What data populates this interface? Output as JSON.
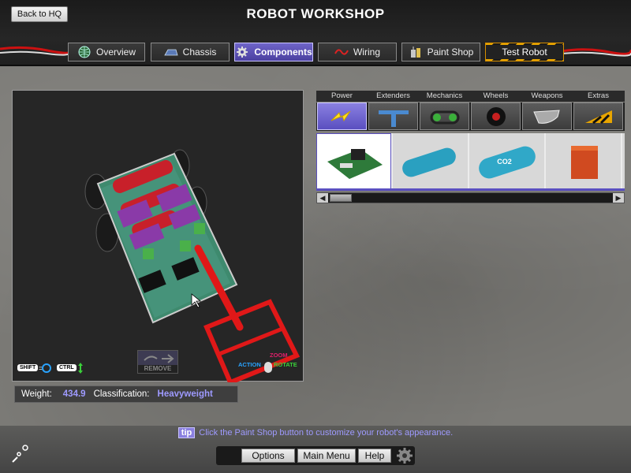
{
  "header": {
    "back_label": "Back to HQ",
    "title": "ROBOT WORKSHOP",
    "tabs": [
      {
        "label": "Overview",
        "icon": "globe-icon"
      },
      {
        "label": "Chassis",
        "icon": "chassis-icon"
      },
      {
        "label": "Components",
        "icon": "gear-icon",
        "active": true
      },
      {
        "label": "Wiring",
        "icon": "wire-icon"
      },
      {
        "label": "Paint Shop",
        "icon": "paint-can-icon"
      },
      {
        "label": "Test Robot",
        "icon": "hazard-stripes"
      }
    ]
  },
  "viewport": {
    "shift_key": "SHIFT",
    "ctrl_key": "CTRL",
    "remove_label": "REMOVE",
    "zoom_label": "ZOOM",
    "action_label": "ACTION",
    "rotate_label": "ROTATE"
  },
  "status": {
    "weight_label": "Weight:",
    "weight_value": "434.9",
    "class_label": "Classification:",
    "class_value": "Heavyweight"
  },
  "parts": {
    "categories": [
      {
        "label": "Power",
        "icon": "lightning-icon",
        "active": true
      },
      {
        "label": "Extenders",
        "icon": "t-extender-icon"
      },
      {
        "label": "Mechanics",
        "icon": "chain-drive-icon"
      },
      {
        "label": "Wheels",
        "icon": "wheel-icon"
      },
      {
        "label": "Weapons",
        "icon": "blade-icon"
      },
      {
        "label": "Extras",
        "icon": "wedge-icon"
      }
    ],
    "items": [
      {
        "name": "circuit-board-part",
        "selected": true
      },
      {
        "name": "blue-tank-part"
      },
      {
        "name": "co2-tank-part",
        "text": "CO2"
      },
      {
        "name": "orange-battery-part"
      }
    ]
  },
  "footer": {
    "tip_badge": "tip",
    "tip_text": "Click the Paint Shop button to customize your robot's appearance.",
    "options_label": "Options",
    "main_menu_label": "Main Menu",
    "help_label": "Help"
  },
  "colors": {
    "accent": "#5a4fc0",
    "accent_text": "#9e9aff",
    "hazard": "#e8a500"
  }
}
